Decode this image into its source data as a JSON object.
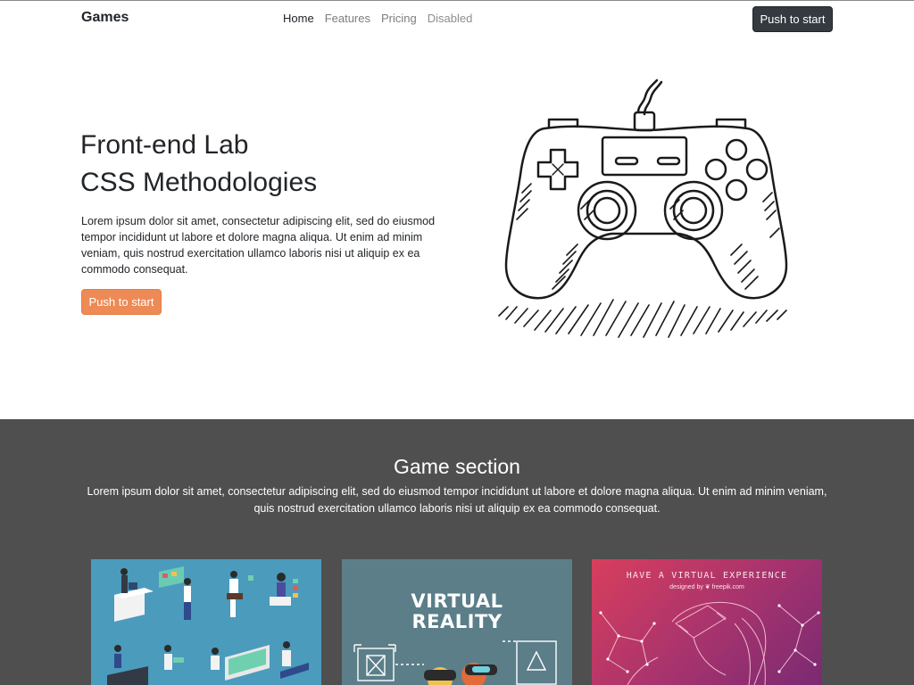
{
  "navbar": {
    "brand": "Games",
    "links": [
      {
        "label": "Home",
        "state": "active"
      },
      {
        "label": "Features",
        "state": "normal"
      },
      {
        "label": "Pricing",
        "state": "normal"
      },
      {
        "label": "Disabled",
        "state": "disabled"
      }
    ],
    "cta_label": "Push to start"
  },
  "hero": {
    "title_line1": "Front-end Lab",
    "title_line2": "CSS Methodologies",
    "text": "Lorem ipsum dolor sit amet, consectetur adipiscing elit, sed do eiusmod tempor incididunt ut labore et dolore magna aliqua. Ut enim ad minim veniam, quis nostrud exercitation ullamco laboris nisi ut aliquip ex ea commodo consequat.",
    "button_label": "Push to start",
    "illustration_icon": "gamepad-icon"
  },
  "game_section": {
    "title": "Game section",
    "text": "Lorem ipsum dolor sit amet, consectetur adipiscing elit, sed do eiusmod tempor incididunt ut labore et dolore magna aliqua. Ut enim ad minim veniam, quis nostrud exercitation ullamco laboris nisi ut aliquip ex ea commodo consequat.",
    "cards": [
      {
        "icon": "isometric-people-illustration"
      },
      {
        "headline_line1": "VIRTUAL",
        "headline_line2": "REALITY",
        "icon": "vr-headset-illustration"
      },
      {
        "headline": "HAVE A VIRTUAL EXPERIENCE",
        "credit": "designed by ❦ freepik.com",
        "icon": "vr-woman-line-illustration"
      }
    ]
  },
  "colors": {
    "accent_button": "#ee8a55",
    "dark_button": "#343a40",
    "section_background": "#4f4f4f"
  }
}
